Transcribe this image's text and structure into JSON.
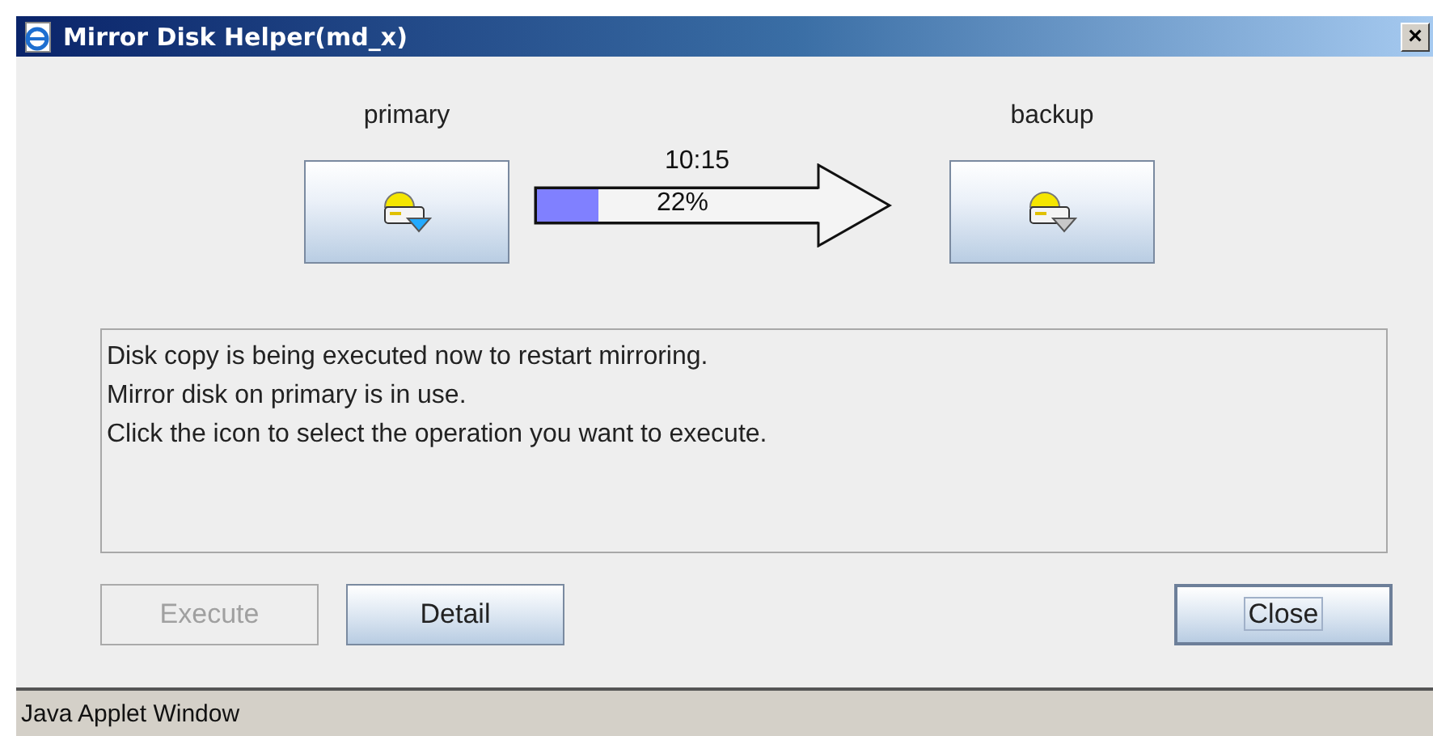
{
  "window": {
    "title": "Mirror Disk Helper(md_x)",
    "close": "×"
  },
  "servers": [
    {
      "label": "primary",
      "kind": "active"
    },
    {
      "label": "backup",
      "kind": "standby"
    }
  ],
  "transfer": {
    "time": "10:15",
    "percent": "22%",
    "level": 0.22
  },
  "messages": [
    "Disk copy is being executed now to restart mirroring.",
    "Mirror disk on primary is in use.",
    "Click the icon to select the operation you want to execute."
  ],
  "buttons": [
    {
      "label": "Execute",
      "disabled": true,
      "focused": false
    },
    {
      "label": "Detail",
      "disabled": false,
      "focused": false
    },
    {
      "label": "Close",
      "disabled": false,
      "focused": true
    }
  ],
  "status_bar": "Java Applet Window"
}
